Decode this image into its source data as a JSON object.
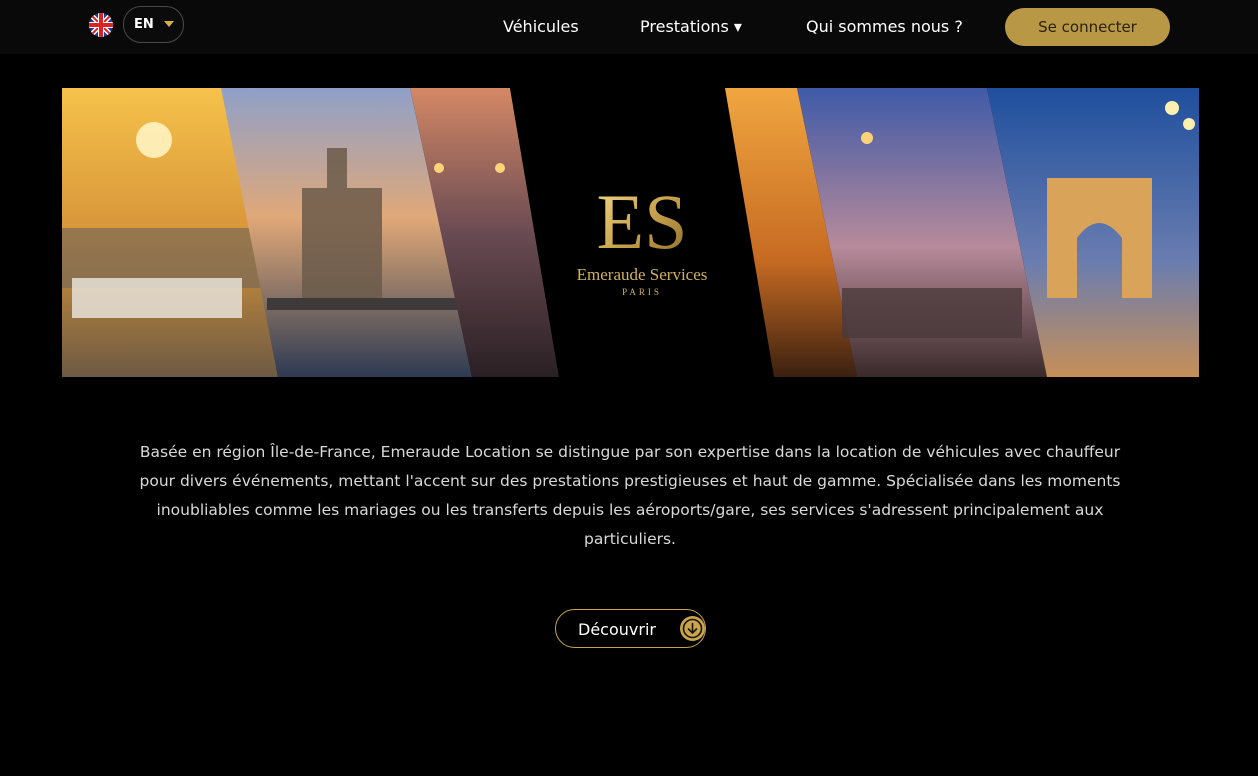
{
  "nav": {
    "language": {
      "flag_icon": "uk-flag-icon",
      "label": "EN"
    },
    "links": [
      {
        "label": "Véhicules"
      },
      {
        "label": "Prestations ▾"
      },
      {
        "label": "Qui sommes nous ?"
      }
    ],
    "login_label": "Se connecter"
  },
  "banner": {
    "brand_name": "Emeraude Services",
    "brand_city": "PARIS",
    "monogram": "ES"
  },
  "main": {
    "description": "Basée en région Île-de-France, Emeraude Location se distingue par son expertise dans la location de véhicules avec chauffeur pour divers événements, mettant l'accent sur des prestations prestigieuses et haut de gamme. Spécialisée dans les moments inoubliables comme les mariages ou les transferts depuis les aéroports/gare, ses services s'adressent principalement aux particuliers.",
    "discover_label": "Découvrir",
    "discover_icon": "arrow-down-circle-icon"
  },
  "colors": {
    "accent_gold": "#b99845",
    "background": "#000000"
  }
}
